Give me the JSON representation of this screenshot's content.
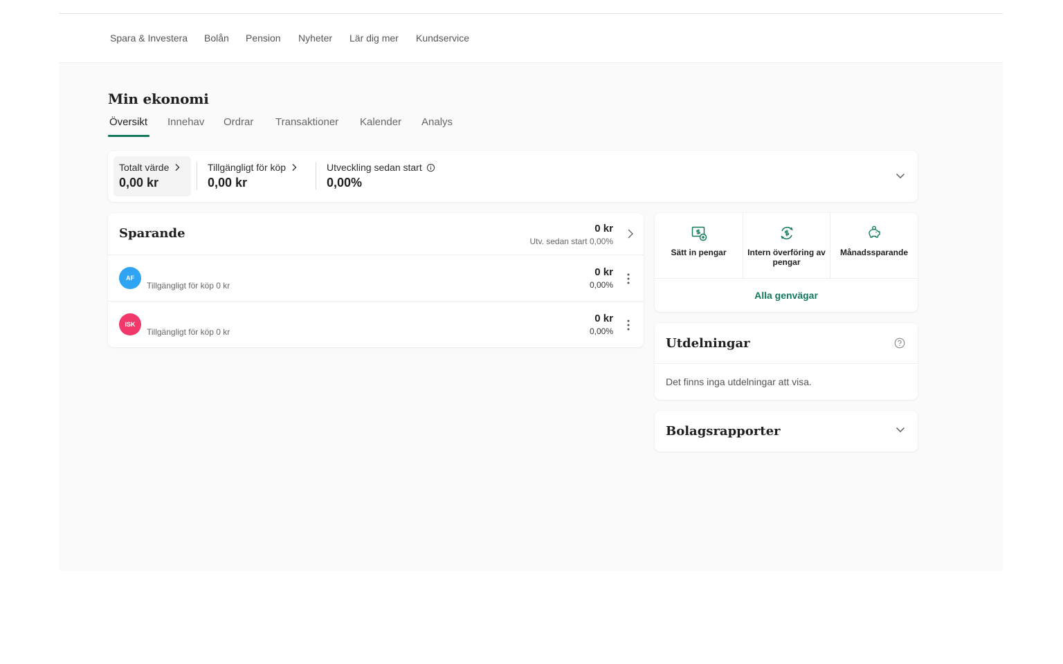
{
  "topnav": {
    "items": [
      "Spara & Investera",
      "Bolån",
      "Pension",
      "Nyheter",
      "Lär dig mer",
      "Kundservice"
    ]
  },
  "page": {
    "title": "Min ekonomi",
    "tabs": [
      "Översikt",
      "Innehav",
      "Ordrar",
      "Transaktioner",
      "Kalender",
      "Analys"
    ],
    "active_tab": "Översikt"
  },
  "summary": {
    "total_label": "Totalt värde",
    "total_value": "0,00 kr",
    "available_label": "Tillgängligt för köp",
    "available_value": "0,00 kr",
    "development_label": "Utveckling sedan start",
    "development_value": "0,00%"
  },
  "sparande": {
    "title": "Sparande",
    "total": "0 kr",
    "total_sub": "Utv. sedan start 0,00%",
    "accounts": [
      {
        "badge": "AF",
        "color": "#2fa4f2",
        "label": "Tillgängligt för köp 0 kr",
        "value": "0 kr",
        "change": "0,00%"
      },
      {
        "badge": "ISK",
        "color": "#f0386b",
        "label": "Tillgängligt för köp 0 kr",
        "value": "0 kr",
        "change": "0,00%"
      }
    ]
  },
  "shortcuts": {
    "items": [
      {
        "label": "Sätt in pengar",
        "icon": "deposit-icon"
      },
      {
        "label": "Intern överföring av pengar",
        "icon": "transfer-icon"
      },
      {
        "label": "Månadssparande",
        "icon": "piggy-bank-icon"
      }
    ],
    "all_label": "Alla genvägar"
  },
  "utdelningar": {
    "title": "Utdelningar",
    "empty": "Det finns inga utdelningar att visa."
  },
  "bolagsrapporter": {
    "title": "Bolagsrapporter"
  },
  "colors": {
    "accent": "#127a5a",
    "background": "#fafafa"
  }
}
